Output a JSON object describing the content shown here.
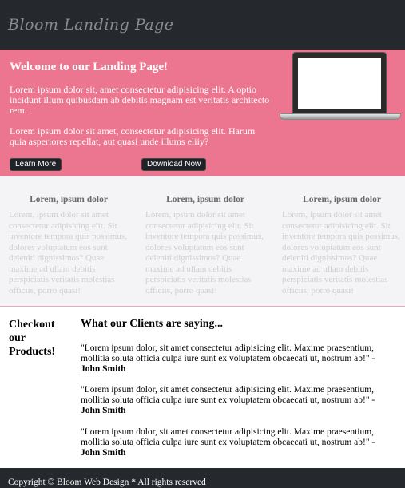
{
  "header": {
    "brand": "Bloom Landing Page"
  },
  "hero": {
    "title": "Welcome to our Landing Page!",
    "paragraph1": "Lorem ipsum dolor sit, amet consectetur adipisicing elit. A optio incidunt illum quibusdam ab debitis magnam est veritatis architecto rem.",
    "paragraph2": "Lorem ipsum dolor sit amet, consectetur adipisicing elit. Harum quia asperiores repellat, aut quasi unde illums eliiy?",
    "learn_more": "Learn More",
    "download_now": "Download Now"
  },
  "features": [
    {
      "title": "Lorem, ipsum dolor",
      "text": "Lorem, ipsum dolor sit amet consectetur adipisicing elit. Sit inventore tempora quis possimus, dolores voluptatum eos sunt deleniti dignissimos? Quae maxime ad ullam debitis perspiciatis veritatis molestias officiis, porro quasi!"
    },
    {
      "title": "Lorem, ipsum dolor",
      "text": "Lorem, ipsum dolor sit amet consectetur adipisicing elit. Sit inventore tempora quis possimus, dolores voluptatum eos sunt deleniti dignissimos? Quae maxime ad ullam debitis perspiciatis veritatis molestias officiis, porro quasi!"
    },
    {
      "title": "Lorem, ipsum dolor",
      "text": "Lorem, ipsum dolor sit amet consectetur adipisicing elit. Sit inventore tempora quis possimus, dolores voluptatum eos sunt deleniti dignissimos? Quae maxime ad ullam debitis perspiciatis veritatis molestias officiis, porro quasi!"
    }
  ],
  "products_heading": "Checkout our Products!",
  "clients": {
    "heading": "What our Clients are saying...",
    "testimonials": [
      {
        "quote": "\"Lorem ipsum dolor, sit amet consectetur adipisicing elit. Maxime praesentium, mollitia soluta officia culpa iure sunt ex voluptatem obcaecati ut, nostrum ab!\" -",
        "author": "John Smith"
      },
      {
        "quote": "\"Lorem ipsum dolor, sit amet consectetur adipisicing elit. Maxime praesentium, mollitia soluta officia culpa iure sunt ex voluptatem obcaecati ut, nostrum ab!\" -",
        "author": "John Smith"
      },
      {
        "quote": "\"Lorem ipsum dolor, sit amet consectetur adipisicing elit. Maxime praesentium, mollitia soluta officia culpa iure sunt ex voluptatem obcaecati ut, nostrum ab!\" -",
        "author": "John Smith"
      }
    ]
  },
  "footer": {
    "copyright": "Copyright © Bloom Web Design * All rights reserved"
  },
  "colors": {
    "header_bg": "#25282c",
    "hero_bg": "#ec7690",
    "features_bg": "#f4f3f5",
    "footer_bg": "#25282c"
  },
  "icons": {
    "hero_image": "laptop-icon"
  }
}
